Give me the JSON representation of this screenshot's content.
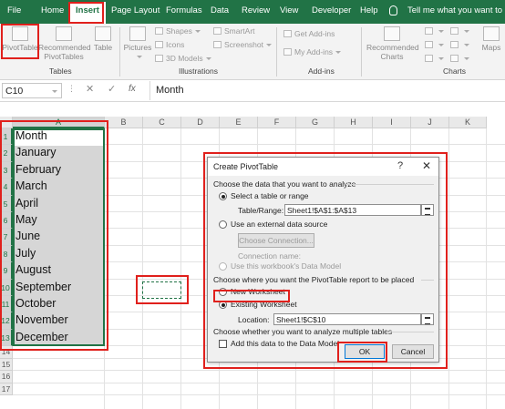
{
  "ribbon": {
    "tabs": [
      "File",
      "Home",
      "Insert",
      "Page Layout",
      "Formulas",
      "Data",
      "Review",
      "View",
      "Developer",
      "Help"
    ],
    "active_tab": "Insert",
    "tell_me": "Tell me what you want to do",
    "groups": {
      "tables": {
        "label": "Tables",
        "pivot": "PivotTable",
        "recommended_1": "Recommended",
        "recommended_2": "PivotTables",
        "table": "Table"
      },
      "illustrations": {
        "label": "Illustrations",
        "pictures": "Pictures",
        "shapes": "Shapes",
        "icons": "Icons",
        "models": "3D Models",
        "smartart": "SmartArt",
        "screenshot": "Screenshot"
      },
      "addins": {
        "label": "Add-ins",
        "get": "Get Add-ins",
        "my": "My Add-ins"
      },
      "charts": {
        "label": "Charts",
        "rec_1": "Recommended",
        "rec_2": "Charts",
        "maps": "Maps"
      }
    }
  },
  "formula_bar": {
    "name_box": "C10",
    "content": "Month"
  },
  "sheet": {
    "columns": [
      "A",
      "B",
      "C",
      "D",
      "E",
      "F",
      "G",
      "H",
      "I",
      "J",
      "K"
    ],
    "rows": [
      "1",
      "2",
      "3",
      "4",
      "5",
      "6",
      "7",
      "8",
      "9",
      "10",
      "11",
      "12",
      "13",
      "14",
      "15",
      "16",
      "17"
    ],
    "col_a": [
      "Month",
      "January",
      "February",
      "March",
      "April",
      "May",
      "June",
      "July",
      "August",
      "September",
      "October",
      "November",
      "December"
    ]
  },
  "dialog": {
    "title": "Create PivotTable",
    "help": "?",
    "close": "✕",
    "section1": "Choose the data that you want to analyze",
    "opt_select_table": "Select a table or range",
    "table_range_label": "Table/Range:",
    "table_range_value": "Sheet1!$A$1:$A$13",
    "opt_external": "Use an external data source",
    "choose_connection": "Choose Connection...",
    "connection_name": "Connection name:",
    "opt_data_model": "Use this workbook's Data Model",
    "section2": "Choose where you want the PivotTable report to be placed",
    "opt_new_ws": "New Worksheet",
    "opt_existing_ws": "Existing Worksheet",
    "location_label": "Location:",
    "location_value": "Sheet1!$C$10",
    "section3": "Choose whether you want to analyze multiple tables",
    "add_data_model": "Add this data to the Data Model",
    "ok": "OK",
    "cancel": "Cancel"
  },
  "colors": {
    "excel_green": "#217346",
    "highlight_red": "#e0201c"
  }
}
